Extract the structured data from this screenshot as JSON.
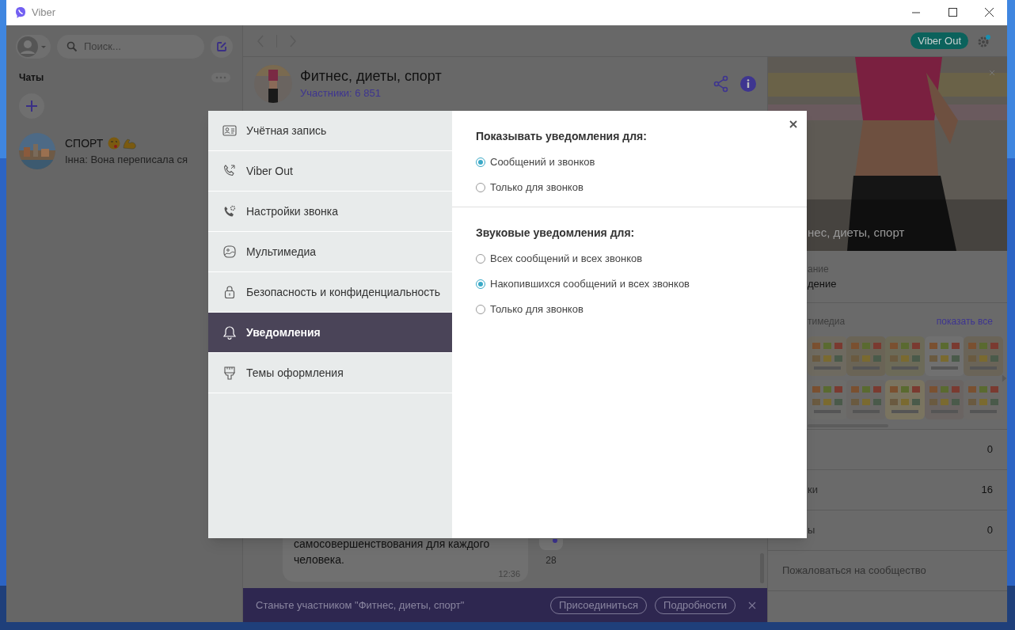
{
  "window": {
    "title": "Viber"
  },
  "sidebar": {
    "search": {
      "placeholder": "Поиск..."
    },
    "section_title": "Чаты",
    "chats": [
      {
        "name": "СПОРТ",
        "preview": "Інна: Вона переписала ся"
      }
    ]
  },
  "top_bar": {
    "viber_out": "Viber Out"
  },
  "chat": {
    "title": "Фитнес, диеты, спорт",
    "members": "Участники: 6 851",
    "message": {
      "text": "самосовершенствования для каждого человека.",
      "time": "12:36"
    },
    "share_count": "28",
    "join_banner": {
      "text": "Станьте участником \"Фитнес, диеты, спорт\"",
      "buttons": [
        "Присоединиться",
        "Подробности"
      ]
    }
  },
  "info_panel": {
    "cover_title": "нес, диеты, спорт",
    "description_label": "ание",
    "description_value": "дение",
    "media_title": "тимедиа",
    "show_all": "показать все",
    "stats": [
      {
        "value": "0"
      },
      {
        "label": "ки",
        "value": "16"
      },
      {
        "label": "ы",
        "value": "0"
      }
    ],
    "report": "Пожаловаться на сообщество"
  },
  "settings_dialog": {
    "menu": [
      {
        "label": "Учётная запись",
        "selected": false
      },
      {
        "label": "Viber Out",
        "selected": false
      },
      {
        "label": "Настройки звонка",
        "selected": false
      },
      {
        "label": "Мультимедиа",
        "selected": false
      },
      {
        "label": "Безопасность и конфиденциальность",
        "selected": false
      },
      {
        "label": "Уведомления",
        "selected": true
      },
      {
        "label": "Темы оформления",
        "selected": false
      }
    ],
    "sections": [
      {
        "title": "Показывать уведомления для:",
        "options": [
          {
            "label": "Сообщений и звонков",
            "selected": true
          },
          {
            "label": "Только для звонков",
            "selected": false
          }
        ]
      },
      {
        "title": "Звуковые уведомления для:",
        "options": [
          {
            "label": "Всех сообщений и всех звонков",
            "selected": false
          },
          {
            "label": "Накопившихся сообщений и всех звонков",
            "selected": true
          },
          {
            "label": "Только для звонков",
            "selected": false
          }
        ]
      }
    ]
  }
}
